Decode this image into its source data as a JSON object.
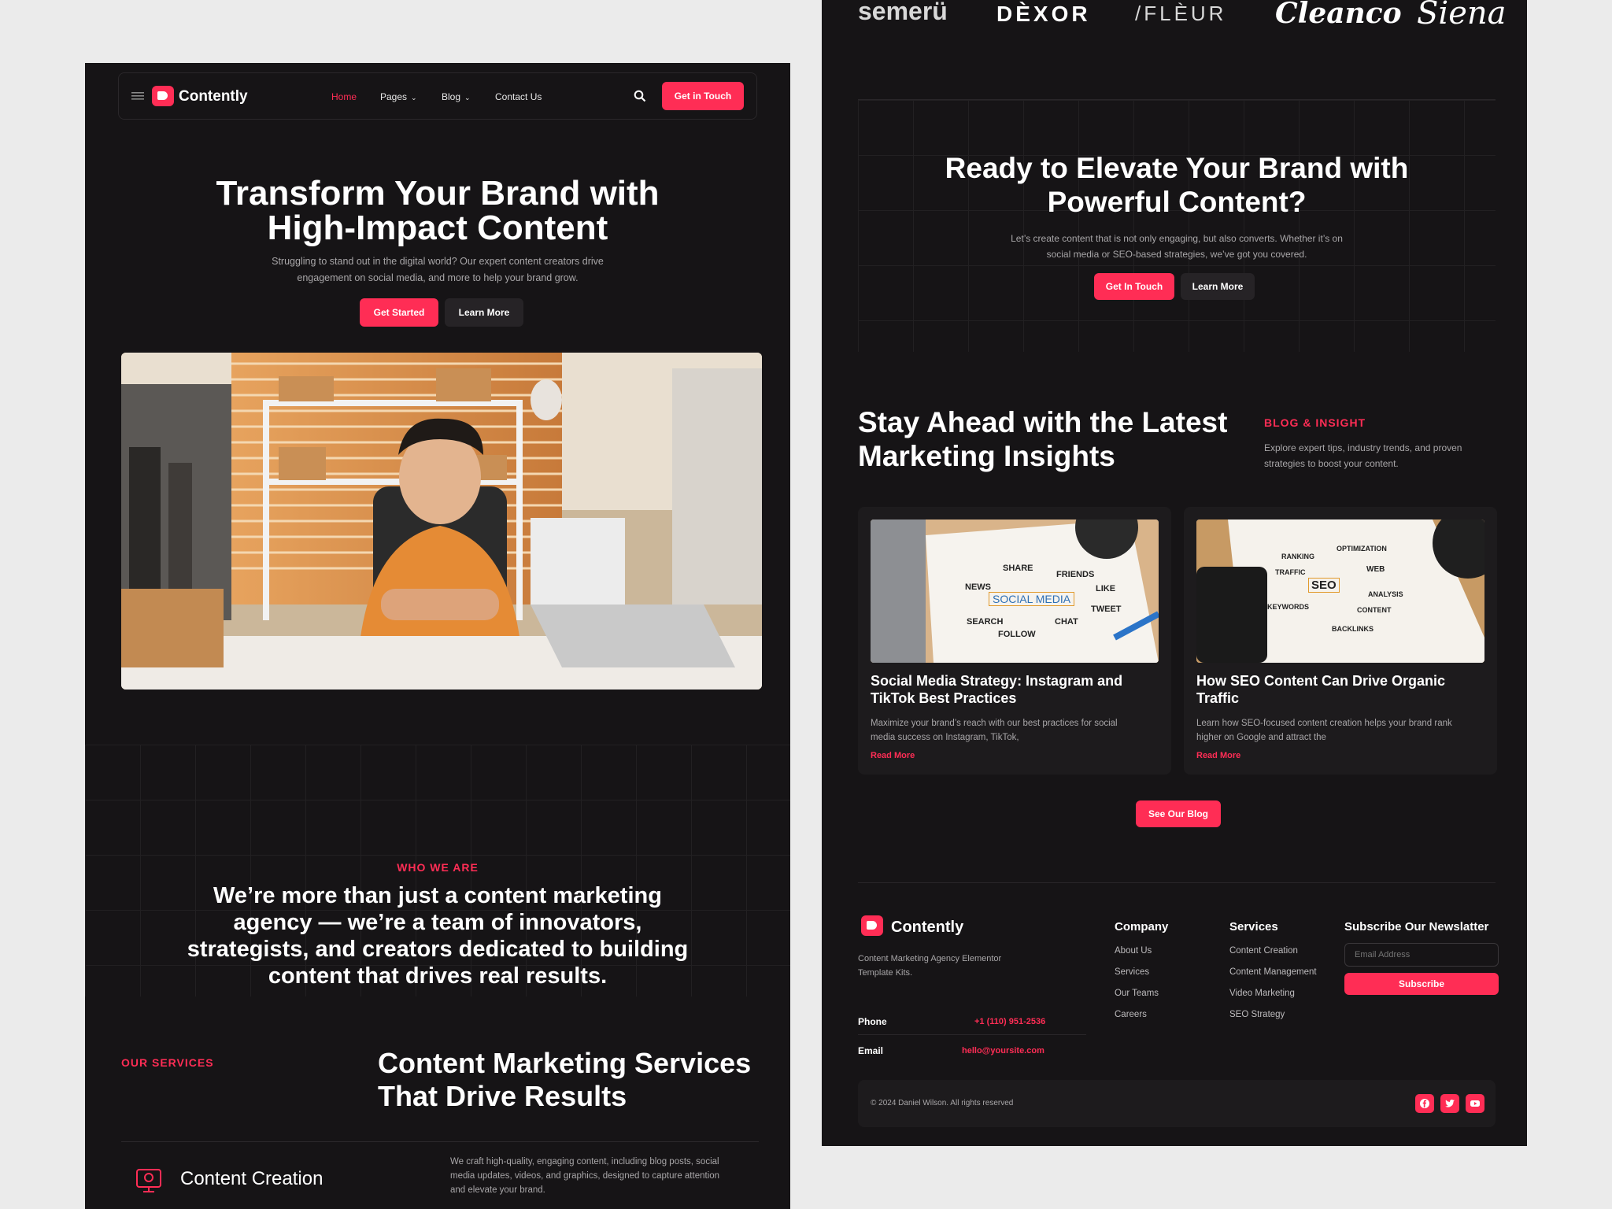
{
  "brand": {
    "name": "Contently",
    "accent": "#ff2d55",
    "background": "#161416"
  },
  "nav": {
    "links": [
      {
        "label": "Home",
        "active": true
      },
      {
        "label": "Pages"
      },
      {
        "label": "Blog"
      },
      {
        "label": "Contact Us"
      }
    ],
    "cta": "Get in Touch",
    "icons": [
      "menu-icon",
      "search-icon"
    ]
  },
  "hero": {
    "title_line1": "Transform Your Brand with",
    "title_line2": "High-Impact Content",
    "subtitle_line1": "Struggling to stand out in the digital world? Our expert content creators drive",
    "subtitle_line2": "engagement on social media, and more to help your brand grow.",
    "primary_button": "Get Started",
    "secondary_button": "Learn More"
  },
  "about": {
    "label": "WHO WE ARE",
    "lines": [
      "We’re more than just a content marketing",
      "agency — we’re a team of innovators,",
      "strategists, and creators dedicated to building",
      "content that drives real results."
    ]
  },
  "services": {
    "label": "OUR SERVICES",
    "title_line1": "Content Marketing Services",
    "title_line2": "That Drive Results",
    "items": [
      {
        "title": "Content Creation",
        "desc_line1": "We craft high-quality, engaging content, including blog posts, social",
        "desc_line2": "media updates, videos, and graphics, designed to capture attention",
        "desc_line3": "and elevate your brand."
      }
    ]
  },
  "partners": [
    "semerü",
    "DÈXOR",
    "/FLÈUR",
    "Cleanco",
    "Siena"
  ],
  "cta": {
    "title_line1": "Ready to Elevate Your Brand with",
    "title_line2": "Powerful Content?",
    "desc_line1": "Let’s create content that is not only engaging, but also converts. Whether it’s on",
    "desc_line2": "social media or SEO-based strategies, we’ve got you covered.",
    "primary_button": "Get In Touch",
    "secondary_button": "Learn More"
  },
  "blog": {
    "title_line1": "Stay Ahead with the Latest",
    "title_line2": "Marketing Insights",
    "label": "BLOG & INSIGHT",
    "desc_line1": "Explore expert tips, industry trends, and proven",
    "desc_line2": "strategies to boost your content.",
    "posts": [
      {
        "title_line1": "Social Media Strategy: Instagram and",
        "title_line2": "TikTok Best Practices",
        "desc_line1": "Maximize your brand’s reach with our best practices for social",
        "desc_line2": "media success on Instagram, TikTok,",
        "link": "Read More",
        "image_words": [
          "SHARE",
          "FRIENDS",
          "NEWS",
          "SOCIAL MEDIA",
          "LIKE",
          "SEARCH",
          "CHAT",
          "TWEET",
          "FOLLOW"
        ]
      },
      {
        "title_line1": "How SEO Content Can Drive Organic",
        "title_line2": "Traffic",
        "desc_line1": "Learn how SEO-focused content creation helps your brand rank",
        "desc_line2": "higher on Google and attract the",
        "link": "Read More",
        "image_words": [
          "OPTIMIZATION",
          "RANKING",
          "WEB",
          "TRAFFIC",
          "SEO",
          "ANALYSIS",
          "KEYWORDS",
          "CONTENT",
          "BACKLINKS"
        ]
      }
    ],
    "see_all": "See Our Blog"
  },
  "footer": {
    "tagline_line1": "Content Marketing Agency Elementor",
    "tagline_line2": "Template Kits.",
    "phone_label": "Phone",
    "phone": "+1 (110) 951-2536",
    "email_label": "Email",
    "email": "hello@yoursite.com",
    "company_head": "Company",
    "company_links": [
      "About Us",
      "Services",
      "Our Teams",
      "Careers"
    ],
    "services_head": "Services",
    "services_links": [
      "Content Creation",
      "Content Management",
      "Video Marketing",
      "SEO Strategy"
    ],
    "newsletter_head": "Subscribe Our Newslatter",
    "email_placeholder": "Email Address",
    "subscribe": "Subscribe",
    "copyright": "© 2024 Daniel Wilson. All rights reserved",
    "social_icons": [
      "facebook-icon",
      "twitter-icon",
      "youtube-icon"
    ]
  }
}
